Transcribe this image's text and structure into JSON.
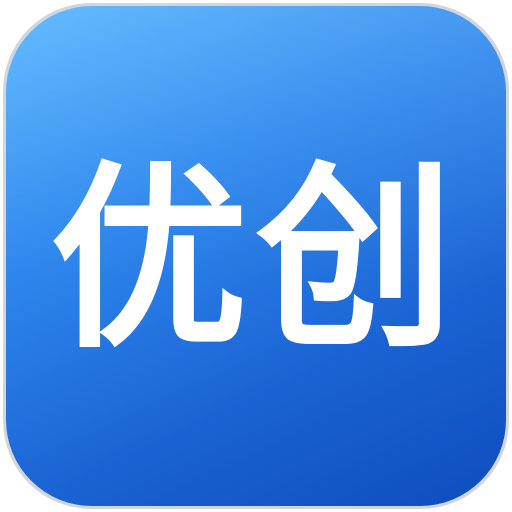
{
  "app_icon": {
    "label": "优创",
    "background_colors": [
      "#55b5ff",
      "#2f89ee",
      "#1a62d3",
      "#0f4cbd"
    ],
    "text_color": "#ffffff"
  }
}
